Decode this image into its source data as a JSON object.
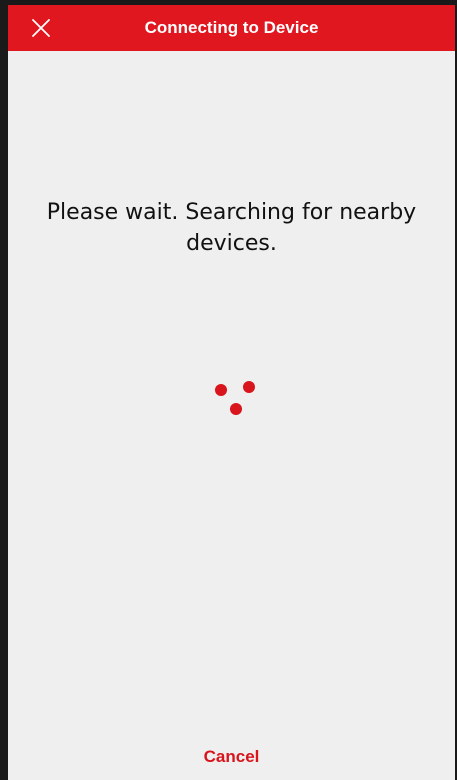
{
  "header": {
    "title": "Connecting to Device",
    "close_icon": "close-icon",
    "background_color": "#e0171f"
  },
  "main": {
    "message": "Please wait. Searching for nearby devices.",
    "spinner_icon": "loading-dots-icon",
    "spinner_color": "#d8141c"
  },
  "footer": {
    "cancel_label": "Cancel"
  }
}
